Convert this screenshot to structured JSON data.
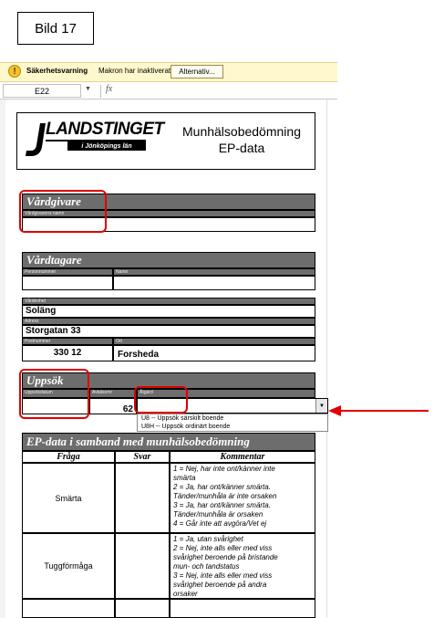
{
  "caption": "Bild 17",
  "security": {
    "title": "Säkerhetsvarning",
    "message": "Makron har inaktiverats.",
    "button": "Alternativ..."
  },
  "formula": {
    "cell_ref": "E22",
    "fx": "fx"
  },
  "header": {
    "logo_name": "LANDSTINGET",
    "logo_sub": "i Jönköpings län",
    "title_line1": "Munhälsobedömning",
    "title_line2": "EP-data"
  },
  "vardgivare": {
    "heading": "Vårdgivare",
    "name_label": "Vårdgivarens namn",
    "name_value": ""
  },
  "vardtagare": {
    "heading": "Vårdtagare",
    "personnummer_label": "Personnummer",
    "personnummer_value": "",
    "namn_label": "Namn",
    "namn_value": "",
    "vardenhet_label": "Vårdenhet",
    "vardenhet_value": "Soläng",
    "adress_label": "Adress",
    "adress_value": "Storgatan 33",
    "postnummer_label": "Postnummer",
    "postnummer_value": "330 12",
    "ort_label": "Ort",
    "ort_value": "Forsheda"
  },
  "uppsok": {
    "heading": "Uppsök",
    "datum_label": "Uppsökdatum",
    "datum_value": "",
    "avtal_label": "Avtalsomr",
    "avtal_value": "62",
    "atgard_label": "Åtgärd",
    "atgard_value": "",
    "options": [
      "U8 -- Uppsök särskilt boende",
      "U8H -- Uppsök ordinärt boende"
    ]
  },
  "epdata": {
    "heading": "EP-data i samband med munhälsobedömning",
    "col_fraga": "Fråga",
    "col_svar": "Svar",
    "col_kommentar": "Kommentar",
    "rows": [
      {
        "fraga": "Smärta",
        "svar": "",
        "kommentar": [
          "1 = Nej, har inte ont/känner inte",
          "smärta",
          "2 = Ja, har ont/känner smärta.",
          "Tänder/munhåla är inte orsaken",
          "3 = Ja, har ont/känner smärta.",
          "Tänder/munhåla är orsaken",
          "4 = Går inte att avgöra/Vet ej"
        ]
      },
      {
        "fraga": "Tuggförmåga",
        "svar": "",
        "kommentar": [
          "1 = Ja, utan svårighet",
          "2 = Nej, inte alls eller med viss",
          "svårighet beroende på bristande",
          "mun- och tandstatus",
          "3 = Nej, inte alls eller med viss",
          "svårighet beroende på andra",
          "orsaker"
        ]
      }
    ]
  }
}
